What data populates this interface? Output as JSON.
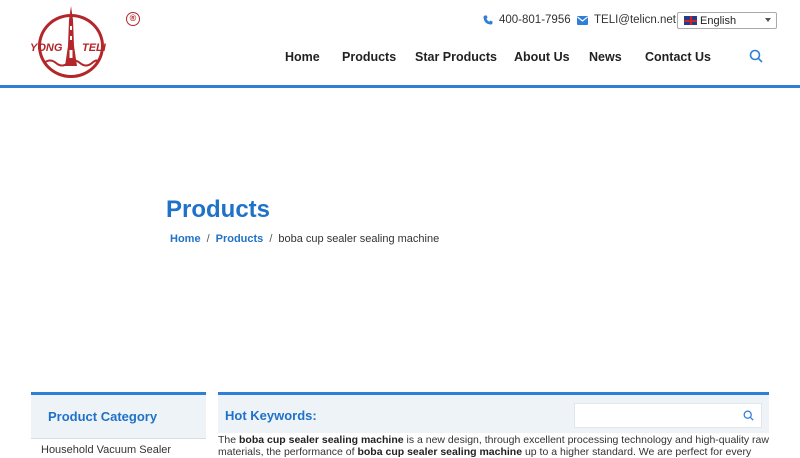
{
  "header": {
    "logo": {
      "left_text": "YONG",
      "right_text": "TELI",
      "registered": "®"
    },
    "phone": "400-801-7956",
    "email": "TELI@telicn.net",
    "language": "English",
    "nav": [
      "Home",
      "Products",
      "Star Products",
      "About Us",
      "News",
      "Contact Us"
    ]
  },
  "banner": {
    "title": "Products",
    "breadcrumb": {
      "home": "Home",
      "products": "Products",
      "current": "boba cup sealer sealing machine"
    }
  },
  "sidebar": {
    "title": "Product Category",
    "first_item": "Household Vacuum Sealer"
  },
  "main": {
    "hot_keywords_label": "Hot Keywords:",
    "search_placeholder": "",
    "description": {
      "pre": "The ",
      "bold1": "boba cup sealer sealing machine",
      "mid": " is a new design, through excellent processing technology and high-quality raw materials, the performance of ",
      "bold2": "boba cup sealer sealing machine",
      "post": " up to a higher standard. We are perfect for every"
    }
  },
  "colors": {
    "accent": "#1f72c7",
    "border": "#2f7fd8",
    "brand_red": "#b3262a",
    "panel": "#eef3f8"
  }
}
